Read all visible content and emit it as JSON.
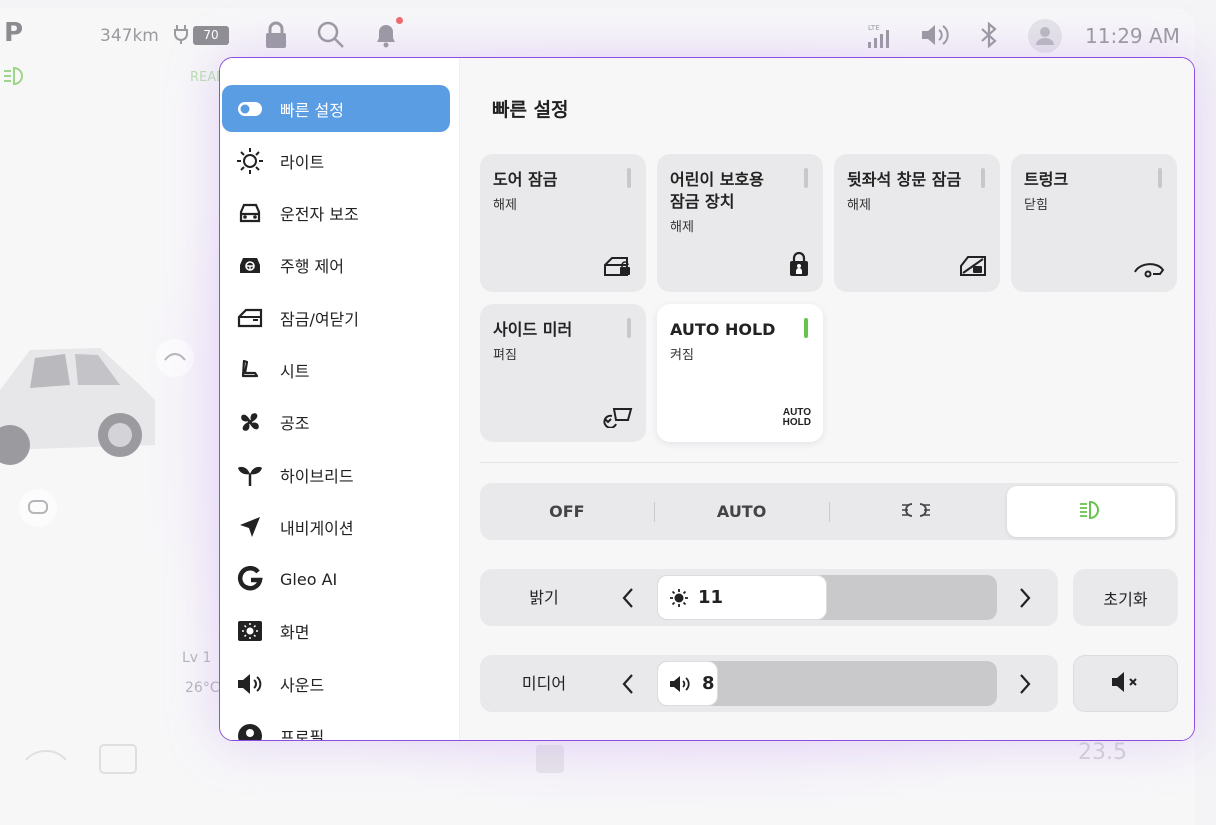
{
  "status_bar": {
    "gear": "P",
    "range": "347km",
    "battery_level": "70",
    "time": "11:29 AM",
    "network": "LTE",
    "icons": [
      "lock-icon",
      "search-icon",
      "bell-icon",
      "signal-icon",
      "volume-icon",
      "bluetooth-icon",
      "avatar-icon"
    ]
  },
  "background": {
    "ready_label": "READ",
    "level": "Lv 1",
    "temp_left": "26°C",
    "temp_right": "23.5"
  },
  "sidebar": {
    "items": [
      {
        "label": "빠른 설정",
        "icon": "toggle-icon",
        "active": true
      },
      {
        "label": "라이트",
        "icon": "sun-icon",
        "active": false
      },
      {
        "label": "운전자 보조",
        "icon": "car-front-icon",
        "active": false
      },
      {
        "label": "주행 제어",
        "icon": "car-steering-icon",
        "active": false
      },
      {
        "label": "잠금/여닫기",
        "icon": "door-icon",
        "active": false
      },
      {
        "label": "시트",
        "icon": "seat-icon",
        "active": false
      },
      {
        "label": "공조",
        "icon": "fan-icon",
        "active": false
      },
      {
        "label": "하이브리드",
        "icon": "sprout-icon",
        "active": false
      },
      {
        "label": "내비게이션",
        "icon": "navigation-arrow-icon",
        "active": false
      },
      {
        "label": "Gleo AI",
        "icon": "gleo-ai-icon",
        "active": false
      },
      {
        "label": "화면",
        "icon": "display-brightness-icon",
        "active": false
      },
      {
        "label": "사운드",
        "icon": "speaker-icon",
        "active": false
      },
      {
        "label": "프로필",
        "icon": "profile-icon",
        "active": false
      }
    ]
  },
  "quick_settings": {
    "title": "빠른 설정",
    "tiles": [
      {
        "title": "도어 잠금",
        "status": "해제",
        "icon": "door-unlock-icon",
        "on": false
      },
      {
        "title": "어린이 보호용\n잠금 장치",
        "title_line1": "어린이 보호용",
        "title_line2": "잠금 장치",
        "status": "해제",
        "icon": "child-lock-icon",
        "on": false
      },
      {
        "title": "뒷좌석 창문 잠금",
        "status": "해제",
        "icon": "window-lock-icon",
        "on": false
      },
      {
        "title": "트렁크",
        "status": "닫힘",
        "icon": "trunk-icon",
        "on": false
      },
      {
        "title": "사이드 미러",
        "status": "펴짐",
        "icon": "side-mirror-icon",
        "on": false
      },
      {
        "title": "AUTO HOLD",
        "status": "켜짐",
        "icon": "auto-hold-icon",
        "icon_text_1": "AUTO",
        "icon_text_2": "HOLD",
        "on": true
      }
    ]
  },
  "light_mode": {
    "options": [
      {
        "label": "OFF",
        "icon": null
      },
      {
        "label": "AUTO",
        "icon": null
      },
      {
        "label": "",
        "icon": "parking-light-icon"
      },
      {
        "label": "",
        "icon": "headlight-icon"
      }
    ],
    "selected_index": 3,
    "accent": "#68c34e"
  },
  "brightness": {
    "label": "밝기",
    "value": "11",
    "fraction": 0.5,
    "reset_label": "초기화"
  },
  "media": {
    "label": "미디어",
    "value": "8",
    "fraction": 0.18
  },
  "colors": {
    "active_blue": "#5b9de3",
    "modal_border": "#8a4ee0",
    "green": "#68c34e"
  }
}
